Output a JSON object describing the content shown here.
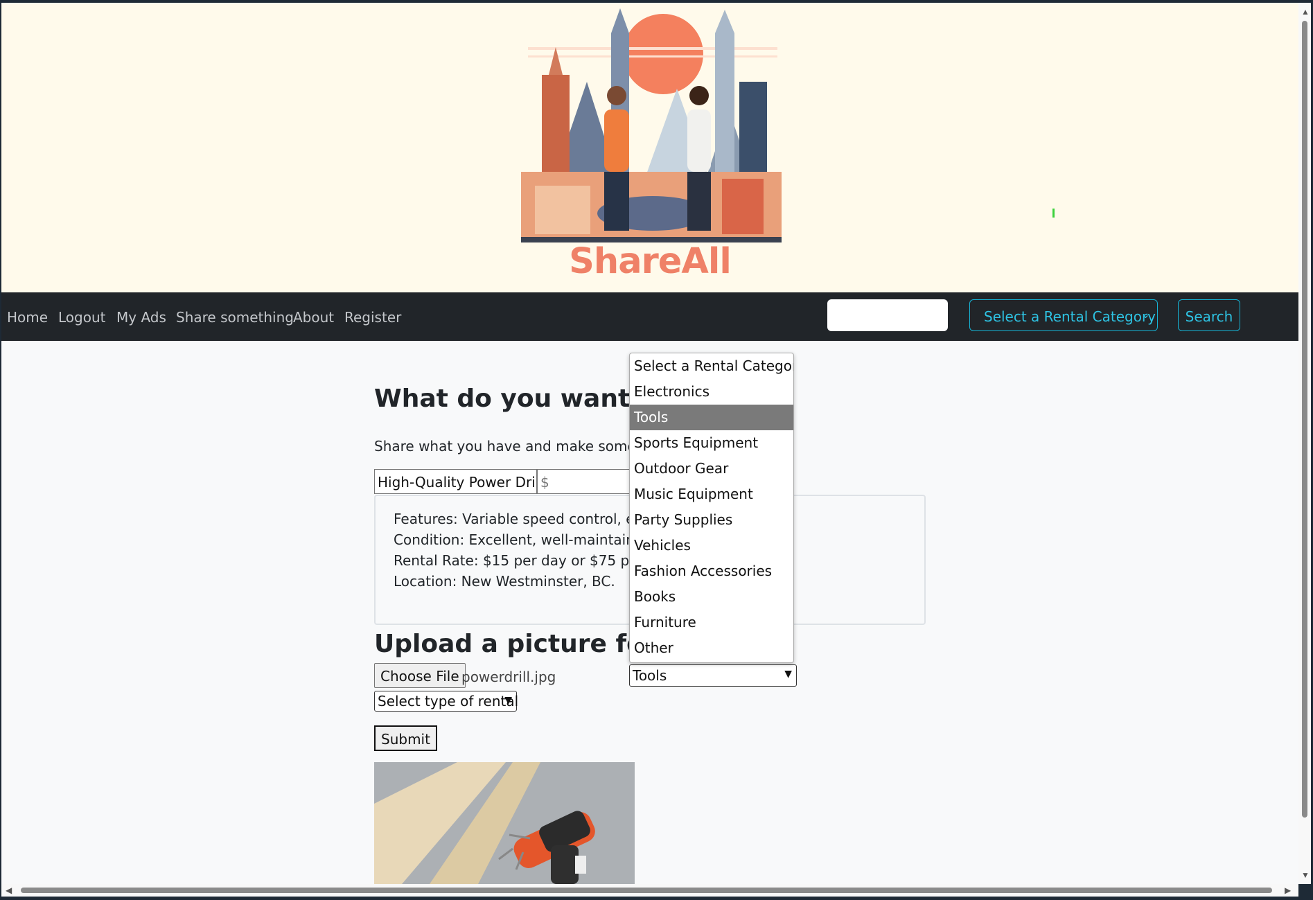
{
  "brand": {
    "name": "ShareAll"
  },
  "nav": {
    "links": [
      "Home",
      "Logout",
      "My Ads",
      "Share something",
      "About",
      "Register"
    ],
    "search_value": "",
    "category_select_label": "Select a Rental Category",
    "search_button": "Search"
  },
  "form": {
    "heading": "What do you want to re",
    "subheading": "Share what you have and make some mor",
    "title_value": "High-Quality Power Drill",
    "price_placeholder": "$",
    "description_lines": [
      "Features: Variable speed control, ergon                              drill bits included.",
      "Condition: Excellent, well-maintained.",
      "Rental Rate: $15 per day or $75 per we",
      "Location: New Westminster, BC."
    ],
    "upload_heading": "Upload a picture for yo",
    "choose_file_label": "Choose File",
    "file_name": "powerdrill.jpg",
    "category_value": "Tools",
    "rental_type_value": "Select type of rental",
    "submit_label": "Submit"
  },
  "dropdown": {
    "options": [
      "Select a Rental Category",
      "Electronics",
      "Tools",
      "Sports Equipment",
      "Outdoor Gear",
      "Music Equipment",
      "Party Supplies",
      "Vehicles",
      "Fashion Accessories",
      "Books",
      "Furniture",
      "Other"
    ],
    "selected_index": 2
  },
  "colors": {
    "brand": "#ef8167",
    "navbar": "#212529",
    "accent": "#16b3d4",
    "header_bg": "#fffaeb"
  }
}
